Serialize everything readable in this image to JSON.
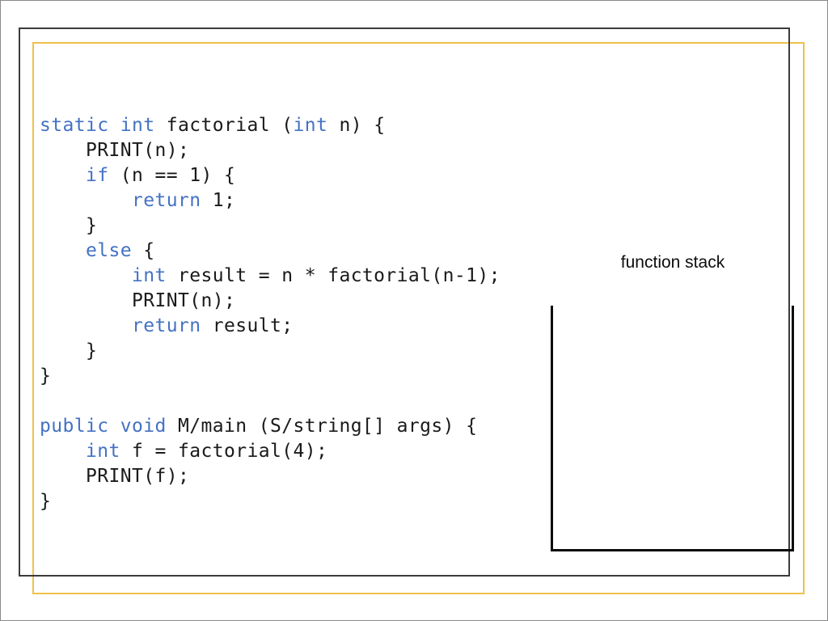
{
  "slide": {
    "background_color": "#ffffff",
    "frames": {
      "gold_border_color": "#eec14a",
      "dark_border_color": "#3b3b3b",
      "edge_border_color": "#8a8a8a"
    }
  },
  "code": {
    "keyword_color": "#4472c4",
    "text_color": "#1a1a1a",
    "lines": [
      [
        {
          "t": "static int",
          "k": true
        },
        {
          "t": " factorial (",
          "k": false
        },
        {
          "t": "int",
          "k": true
        },
        {
          "t": " n) {",
          "k": false
        }
      ],
      [
        {
          "t": "    PRINT(n);",
          "k": false
        }
      ],
      [
        {
          "t": "    ",
          "k": false
        },
        {
          "t": "if",
          "k": true
        },
        {
          "t": " (n == 1) {",
          "k": false
        }
      ],
      [
        {
          "t": "        ",
          "k": false
        },
        {
          "t": "return",
          "k": true
        },
        {
          "t": " 1;",
          "k": false
        }
      ],
      [
        {
          "t": "    }",
          "k": false
        }
      ],
      [
        {
          "t": "    ",
          "k": false
        },
        {
          "t": "else",
          "k": true
        },
        {
          "t": " {",
          "k": false
        }
      ],
      [
        {
          "t": "        ",
          "k": false
        },
        {
          "t": "int",
          "k": true
        },
        {
          "t": " result = n * factorial(n-1);",
          "k": false
        }
      ],
      [
        {
          "t": "        PRINT(n);",
          "k": false
        }
      ],
      [
        {
          "t": "        ",
          "k": false
        },
        {
          "t": "return",
          "k": true
        },
        {
          "t": " result;",
          "k": false
        }
      ],
      [
        {
          "t": "    }",
          "k": false
        }
      ],
      [
        {
          "t": "}",
          "k": false
        }
      ],
      [
        {
          "t": "",
          "k": false
        }
      ],
      [
        {
          "t": "public void",
          "k": true
        },
        {
          "t": " M/main (S/string[] args) {",
          "k": false
        }
      ],
      [
        {
          "t": "    ",
          "k": false
        },
        {
          "t": "int",
          "k": true
        },
        {
          "t": " f = factorial(4);",
          "k": false
        }
      ],
      [
        {
          "t": "    PRINT(f);",
          "k": false
        }
      ],
      [
        {
          "t": "}",
          "k": false
        }
      ]
    ]
  },
  "function_stack": {
    "label": "function stack",
    "border_color": "#0a0a0a",
    "open_side": "top",
    "frames": []
  }
}
